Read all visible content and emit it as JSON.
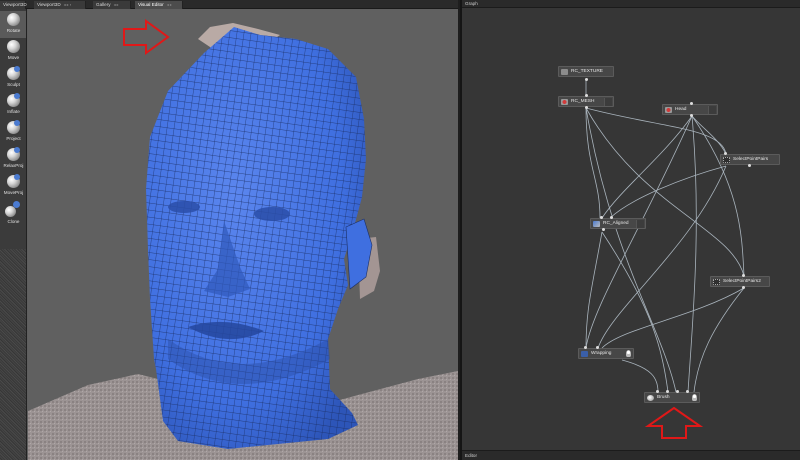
{
  "tabs": [
    {
      "label": "Viewport3D",
      "active": false
    },
    {
      "label": "Viewport3D",
      "active": false
    },
    {
      "label": "Gallery",
      "active": false
    },
    {
      "label": "Visual Editor",
      "active": true
    }
  ],
  "tools": [
    {
      "label": "Rotate",
      "icon": "sphere-icon",
      "active": true
    },
    {
      "label": "Move",
      "icon": "sphere-icon"
    },
    {
      "label": "Sculpt",
      "icon": "sphere-brush-icon"
    },
    {
      "label": "Inflate",
      "icon": "sphere-brush-icon"
    },
    {
      "label": "Project",
      "icon": "sphere-brush-icon"
    },
    {
      "label": "RelaxProj",
      "icon": "sphere-brush-icon"
    },
    {
      "label": "MoveProj",
      "icon": "sphere-brush-icon"
    },
    {
      "label": "Clone",
      "icon": "sphere-clone-icon"
    }
  ],
  "graph": {
    "title": "Graph",
    "footer": "Editor",
    "nodes": {
      "rc_texture": "RC_TEXTURE",
      "rc_mesh": "RC_MESH",
      "head": "Head",
      "select_point_pairs": "SelectPointPairs",
      "rc_aligned": "RC_Aligned",
      "select_point_pairs2": "SelectPointPairs2",
      "wrapping": "Wrapping",
      "brush": "Brush"
    }
  },
  "colors": {
    "mesh_blue": "#3f6fe0",
    "wire": "#1b2f66",
    "scan_skin": "#b7a7a0",
    "annotation_red": "#e01818",
    "node_bg": "#474747",
    "wire_line": "#b6c2cc"
  }
}
